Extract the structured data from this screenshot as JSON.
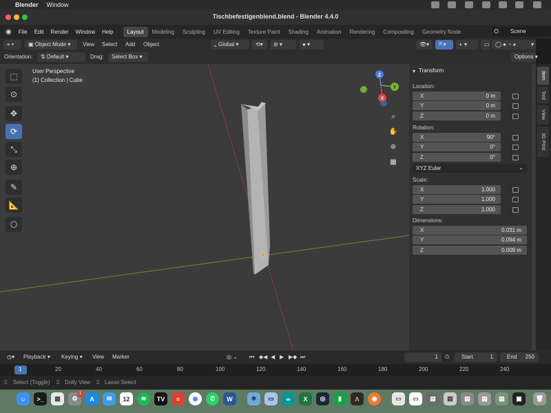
{
  "mac_menubar": {
    "app_name": "Blender",
    "items": [
      "Window"
    ]
  },
  "window": {
    "title": "Tischbefestigenblend.blend - Blender 4.4.0"
  },
  "menus": [
    "File",
    "Edit",
    "Render",
    "Window",
    "Help"
  ],
  "workspaces": [
    {
      "label": "Layout",
      "active": true
    },
    {
      "label": "Modeling"
    },
    {
      "label": "Sculpting"
    },
    {
      "label": "UV Editing"
    },
    {
      "label": "Texture Paint"
    },
    {
      "label": "Shading"
    },
    {
      "label": "Animation"
    },
    {
      "label": "Rendering"
    },
    {
      "label": "Compositing"
    },
    {
      "label": "Geometry Node"
    }
  ],
  "scene": {
    "label": "Scene"
  },
  "header": {
    "mode": "Object Mode",
    "menu_view": "View",
    "menu_select": "Select",
    "menu_add": "Add",
    "menu_object": "Object",
    "transform_orientation": "Global"
  },
  "tool_settings": {
    "orientation_label": "Orientation:",
    "orientation_value": "Default",
    "drag_label": "Drag:",
    "drag_value": "Select Box",
    "options_label": "Options"
  },
  "viewport": {
    "perspective": "User Perspective",
    "collection": "(1) Collection | Cube",
    "gizmo": {
      "z": "Z",
      "y": "Y",
      "x": "X"
    }
  },
  "sidebar": {
    "panel_title": "Transform",
    "location": {
      "label": "Location:",
      "x": "0 m",
      "y": "0 m",
      "z": "0 m"
    },
    "rotation": {
      "label": "Rotation:",
      "x": "90°",
      "y": "0°",
      "z": "0°"
    },
    "rotation_mode": "XYZ Euler",
    "scale": {
      "label": "Scale:",
      "x": "1.000",
      "y": "1.000",
      "z": "1.000"
    },
    "dimensions": {
      "label": "Dimensions:",
      "x": "0.031 m",
      "y": "0.094 m",
      "z": "0.009 m"
    },
    "axis_labels": {
      "x": "X",
      "y": "Y",
      "z": "Z"
    },
    "tabs": [
      "Item",
      "Tool",
      "View",
      "3D Print"
    ]
  },
  "timeline": {
    "playback": "Playback",
    "keying": "Keying",
    "view": "View",
    "marker": "Marker",
    "current_frame": "1",
    "start_label": "Start",
    "start_value": "1",
    "end_label": "End",
    "end_value": "250",
    "ruler_ticks": [
      "1",
      "20",
      "40",
      "60",
      "80",
      "100",
      "120",
      "140",
      "160",
      "180",
      "200",
      "220",
      "240"
    ]
  },
  "statusbar": {
    "select": "Select (Toggle)",
    "dolly": "Dolly View",
    "lasso": "Lasso Select"
  },
  "dock": {
    "calendar_day": "12",
    "badge_count": "1"
  }
}
